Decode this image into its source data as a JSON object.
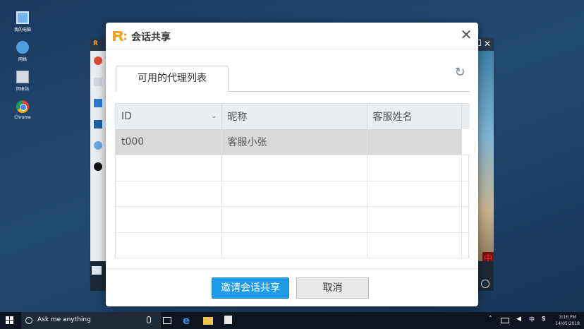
{
  "desktop": {
    "icons": [
      {
        "label": "我的电脑",
        "icon": "computer-icon"
      },
      {
        "label": "网络",
        "icon": "network-icon"
      },
      {
        "label": "回收站",
        "icon": "recycle-bin-icon"
      },
      {
        "label": "Chrome",
        "icon": "chrome-icon"
      }
    ]
  },
  "remote_window": {
    "overlay_text": "中"
  },
  "dialog": {
    "title": "会话共享",
    "close_icon": "close-icon",
    "tab_label": "可用的代理列表",
    "refresh_icon": "refresh-icon",
    "table": {
      "columns": [
        "ID",
        "昵称",
        "客服姓名"
      ],
      "rows": [
        {
          "id": "t000",
          "nickname": "客服小张",
          "name": ""
        }
      ],
      "empty_rows": 4
    },
    "buttons": {
      "invite": "邀请会话共享",
      "cancel": "取消"
    }
  },
  "taskbar": {
    "search_placeholder": "Ask me anything",
    "time": "3:16 PM",
    "date": "14/05/2018"
  },
  "colors": {
    "primary_button": "#1e9be6",
    "selected_row": "#d9d9d9",
    "desktop_bg": "#1b3a5e"
  }
}
